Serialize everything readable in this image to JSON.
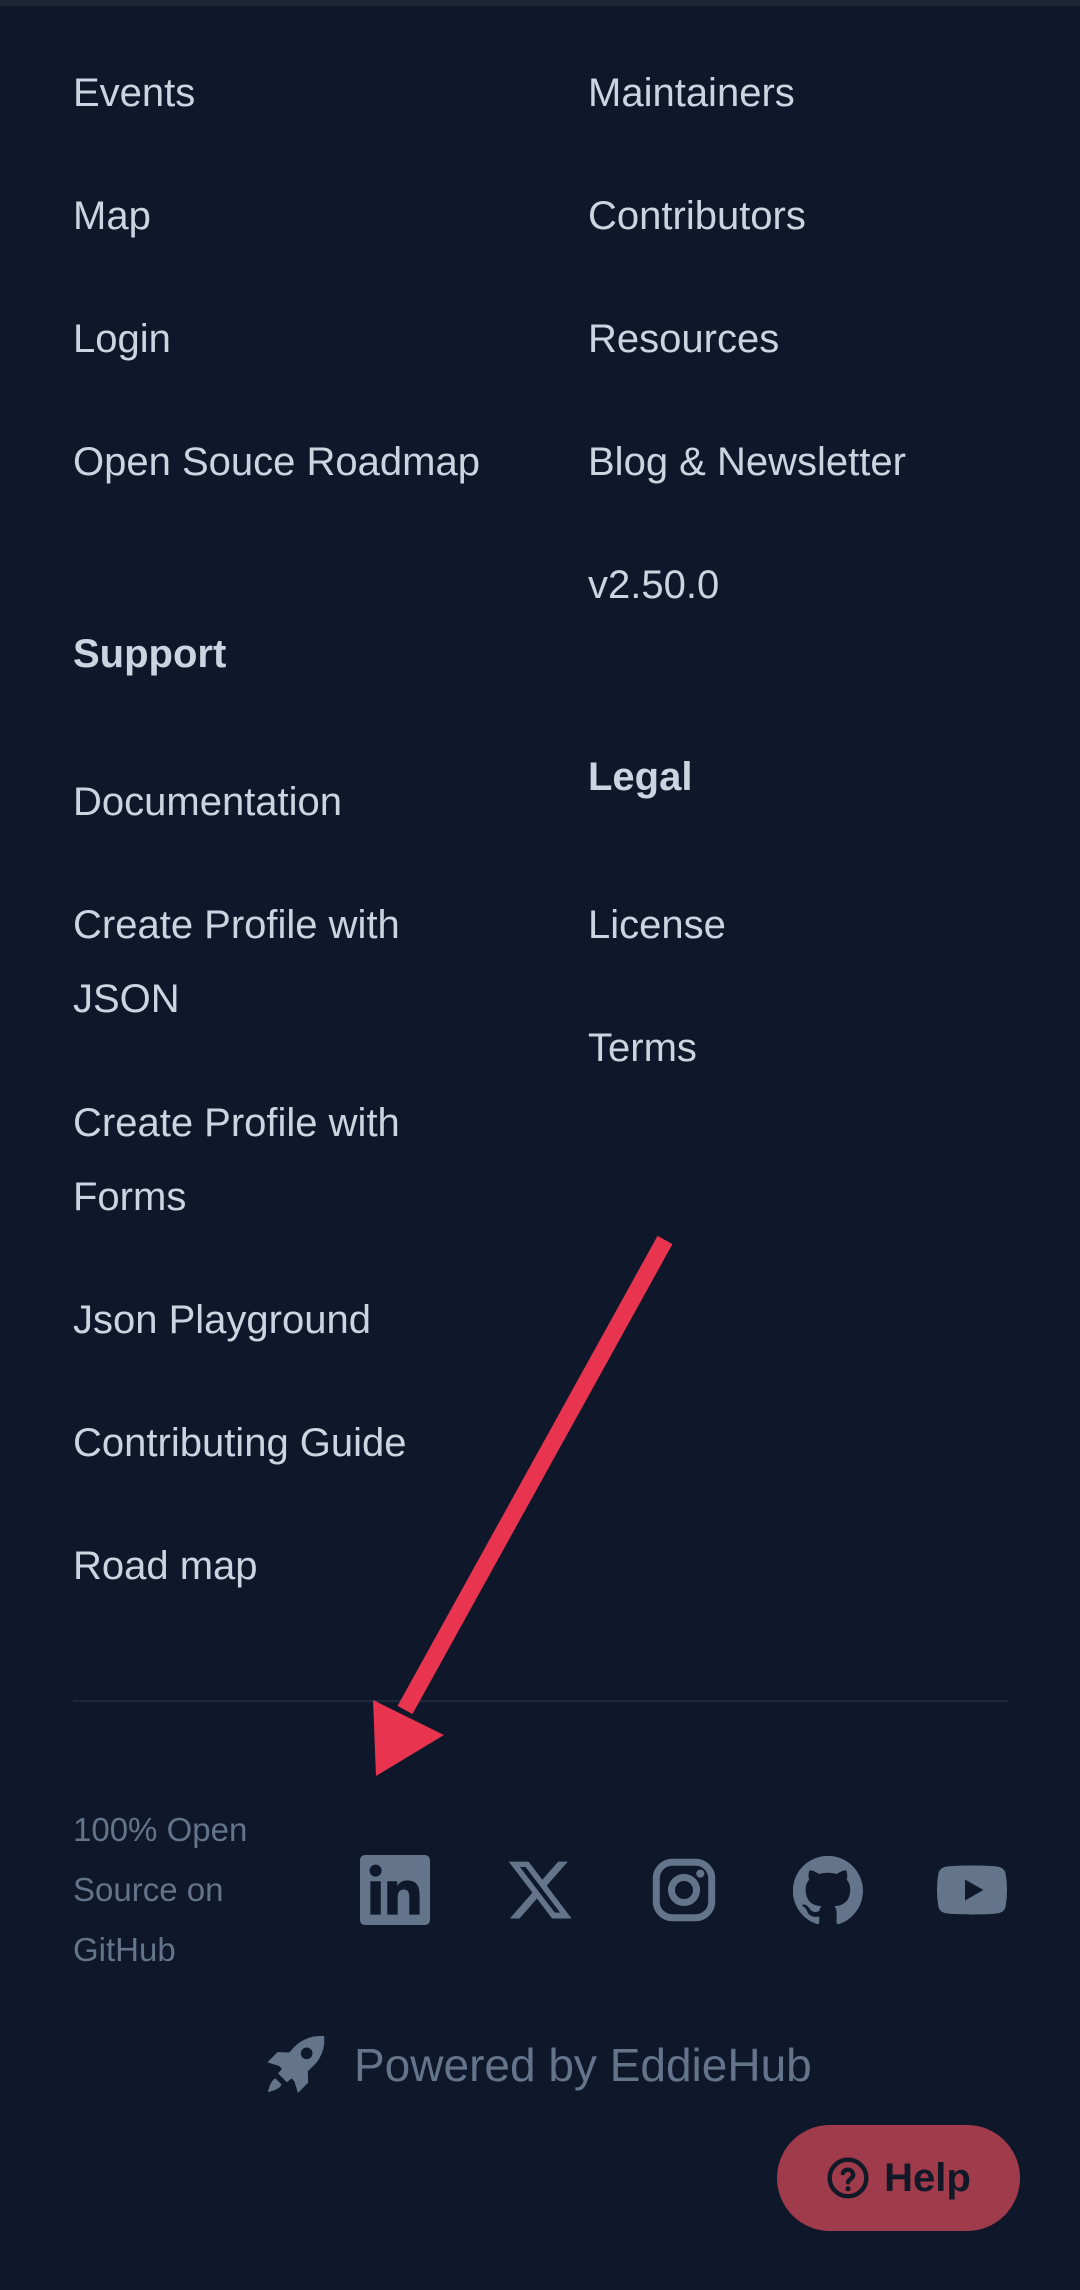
{
  "footer": {
    "left_links": [
      "Events",
      "Map",
      "Login",
      "Open Souce Roadmap"
    ],
    "right_links": [
      "Maintainers",
      "Contributors",
      "Resources",
      "Blog & Newsletter",
      "v2.50.0"
    ],
    "support": {
      "heading": "Support",
      "links": [
        "Documentation",
        "Create Profile with JSON",
        "Create Profile with Forms",
        "Json Playground",
        "Contributing Guide",
        "Road map"
      ]
    },
    "legal": {
      "heading": "Legal",
      "links": [
        "License",
        "Terms"
      ]
    },
    "open_source_text": "100% Open Source on GitHub",
    "social_icons": [
      "linkedin-icon",
      "x-icon",
      "instagram-icon",
      "github-icon",
      "youtube-icon"
    ],
    "powered_by": "Powered by EddieHub"
  },
  "help_button": {
    "label": "Help"
  },
  "colors": {
    "background": "#0f172a",
    "link": "#cbd5e1",
    "muted": "#64748b",
    "help_bg": "#9f3b4a",
    "annotation_arrow": "#e8344f"
  }
}
